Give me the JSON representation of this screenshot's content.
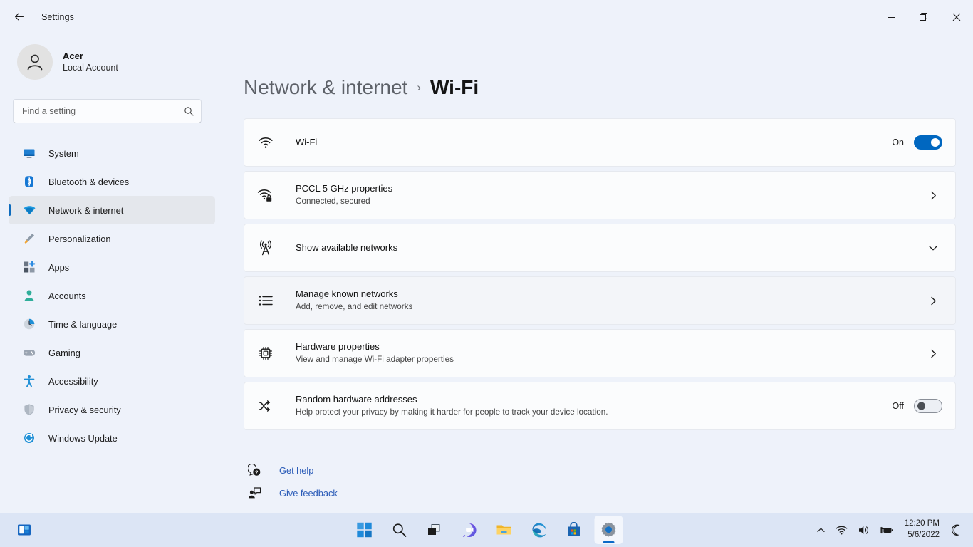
{
  "window": {
    "app_title": "Settings",
    "back_icon": "back-arrow-icon",
    "controls": {
      "minimize": "—",
      "maximize": "❐",
      "close": "✕"
    }
  },
  "sidebar": {
    "account": {
      "name": "Acer",
      "subtitle": "Local Account",
      "avatar_icon": "person-avatar-icon"
    },
    "search": {
      "placeholder": "Find a setting",
      "value": "",
      "icon": "search-icon"
    },
    "items": [
      {
        "label": "System",
        "icon": "monitor-icon",
        "active": false
      },
      {
        "label": "Bluetooth & devices",
        "icon": "bluetooth-icon",
        "active": false
      },
      {
        "label": "Network & internet",
        "icon": "wifi-icon",
        "active": true
      },
      {
        "label": "Personalization",
        "icon": "paintbrush-icon",
        "active": false
      },
      {
        "label": "Apps",
        "icon": "apps-grid-icon",
        "active": false
      },
      {
        "label": "Accounts",
        "icon": "person-icon",
        "active": false
      },
      {
        "label": "Time & language",
        "icon": "clock-globe-icon",
        "active": false
      },
      {
        "label": "Gaming",
        "icon": "gamepad-icon",
        "active": false
      },
      {
        "label": "Accessibility",
        "icon": "accessibility-icon",
        "active": false
      },
      {
        "label": "Privacy & security",
        "icon": "shield-icon",
        "active": false
      },
      {
        "label": "Windows Update",
        "icon": "update-refresh-icon",
        "active": false
      }
    ]
  },
  "breadcrumb": {
    "parent": "Network & internet",
    "separator": "›",
    "current": "Wi-Fi"
  },
  "cards": [
    {
      "title": "Wi-Fi",
      "subtitle": "",
      "icon": "wifi-icon",
      "control": "toggle",
      "state_label": "On",
      "state_on": true
    },
    {
      "title": "PCCL 5 GHz properties",
      "subtitle": "Connected, secured",
      "icon": "wifi-secured-icon",
      "control": "chevron-right",
      "state_label": "",
      "state_on": null
    },
    {
      "title": "Show available networks",
      "subtitle": "",
      "icon": "broadcast-tower-icon",
      "control": "chevron-down",
      "state_label": "",
      "state_on": null
    },
    {
      "title": "Manage known networks",
      "subtitle": "Add, remove, and edit networks",
      "icon": "bulleted-list-icon",
      "control": "chevron-right",
      "state_label": "",
      "state_on": null,
      "hovered": true
    },
    {
      "title": "Hardware properties",
      "subtitle": "View and manage Wi-Fi adapter properties",
      "icon": "cpu-chip-icon",
      "control": "chevron-right",
      "state_label": "",
      "state_on": null
    },
    {
      "title": "Random hardware addresses",
      "subtitle": "Help protect your privacy by making it harder for people to track your device location.",
      "icon": "shuffle-icon",
      "control": "toggle",
      "state_label": "Off",
      "state_on": false
    }
  ],
  "links": [
    {
      "label": "Get help",
      "icon": "help-question-icon"
    },
    {
      "label": "Give feedback",
      "icon": "feedback-person-icon"
    }
  ],
  "taskbar": {
    "widgets_icon": "widgets-icon",
    "buttons": [
      {
        "name": "start",
        "icon": "windows-start-icon",
        "active": false
      },
      {
        "name": "search",
        "icon": "search-icon",
        "active": false
      },
      {
        "name": "task-view",
        "icon": "task-view-icon",
        "active": false
      },
      {
        "name": "chat",
        "icon": "chat-teams-icon",
        "active": false
      },
      {
        "name": "file-explorer",
        "icon": "folder-icon",
        "active": false
      },
      {
        "name": "edge",
        "icon": "edge-browser-icon",
        "active": false
      },
      {
        "name": "microsoft-store",
        "icon": "store-bag-icon",
        "active": false
      },
      {
        "name": "settings",
        "icon": "gear-icon",
        "active": true
      }
    ],
    "tray": {
      "overflow_icon": "chevron-up-icon",
      "network_icon": "wifi-icon",
      "volume_icon": "speaker-icon",
      "battery_icon": "battery-charging-icon",
      "notifications_icon": "moon-icon",
      "time": "12:20 PM",
      "date": "5/6/2022"
    }
  },
  "colors": {
    "accent": "#0067c0",
    "selection_bar": "#0f6cbd",
    "link": "#2b5cb8",
    "page_background": "#eef2fa",
    "card_background": "#fbfcfd",
    "taskbar_background": "#dce5f5"
  }
}
